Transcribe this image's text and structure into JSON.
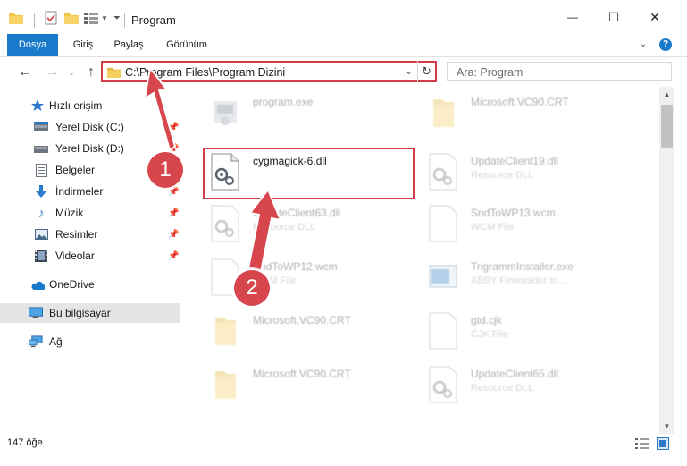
{
  "window": {
    "title": "Program",
    "minimize_glyph": "—",
    "maximize_glyph": "☐",
    "close_glyph": "✕"
  },
  "ribbon": {
    "tabs": [
      {
        "label": "Dosya"
      },
      {
        "label": "Giriş"
      },
      {
        "label": "Paylaş"
      },
      {
        "label": "Görünüm"
      }
    ]
  },
  "address": {
    "path": "C:\\Program Files\\Program Dizini",
    "search_placeholder": "Ara: Program"
  },
  "nav": {
    "items": [
      {
        "label": "Hızlı erişim",
        "icon": "star-icon"
      },
      {
        "label": "Yerel Disk (C:)",
        "icon": "drive-icon"
      },
      {
        "label": "Yerel Disk (D:)",
        "icon": "drive-icon"
      },
      {
        "label": "Belgeler",
        "icon": "documents-icon"
      },
      {
        "label": "İndirmeler",
        "icon": "download-icon"
      },
      {
        "label": "Müzik",
        "icon": "music-icon"
      },
      {
        "label": "Resimler",
        "icon": "pictures-icon"
      },
      {
        "label": "Videolar",
        "icon": "videos-icon"
      },
      {
        "label": "OneDrive",
        "icon": "cloud-icon"
      },
      {
        "label": "Bu bilgisayar",
        "icon": "computer-icon"
      },
      {
        "label": "Ağ",
        "icon": "network-icon"
      }
    ]
  },
  "files": [
    {
      "name": "program.exe",
      "sub": "",
      "type": "exe"
    },
    {
      "name": "Microsoft.VC90.CRT",
      "sub": "",
      "type": "folder"
    },
    {
      "name": "cygmagick-6.dll",
      "sub": "",
      "type": "dll"
    },
    {
      "name": "UpdateClient19.dll",
      "sub": "Resource DLL",
      "type": "dll"
    },
    {
      "name": "UpdateClient63.dll",
      "sub": "Resource DLL",
      "type": "dll"
    },
    {
      "name": "SndToWP13.wcm",
      "sub": "WCM File",
      "type": "doc"
    },
    {
      "name": "SndToWP12.wcm",
      "sub": "WCM File",
      "type": "doc"
    },
    {
      "name": "TrigrammInstaller.exe",
      "sub": "ABBY Finereader tri...",
      "type": "app"
    },
    {
      "name": "Microsoft.VC90.CRT",
      "sub": "",
      "type": "folder"
    },
    {
      "name": "gtd.cjk",
      "sub": "CJK File",
      "type": "doc"
    },
    {
      "name": "Microsoft.VC90.CRT",
      "sub": "",
      "type": "folder"
    },
    {
      "name": "UpdateClient65.dll",
      "sub": "Resource DLL",
      "type": "dll"
    }
  ],
  "status": {
    "count": "147 öğe"
  },
  "annotations": {
    "step1": "1",
    "step2": "2"
  },
  "colors": {
    "accent": "#1979ca",
    "highlight": "#d33d47",
    "badge": "#d7454d"
  }
}
